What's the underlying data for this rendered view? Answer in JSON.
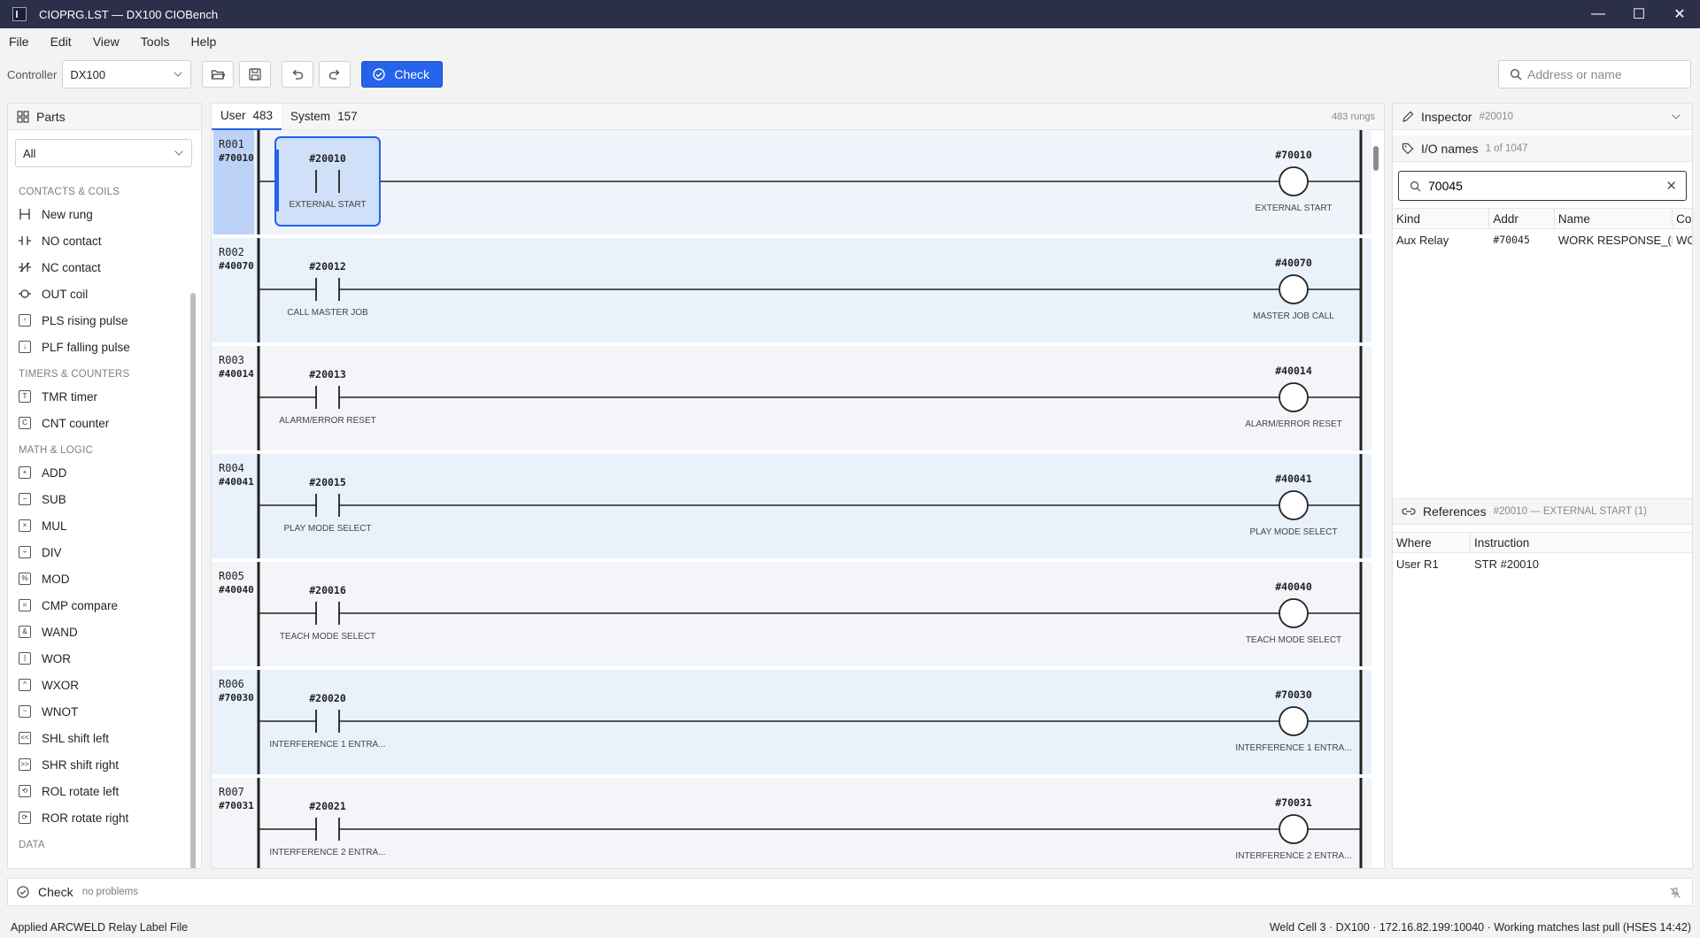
{
  "window": {
    "title": "CIOPRG.LST — DX100 CIOBench",
    "min": "—",
    "max": "☐",
    "close": "✕"
  },
  "menu": [
    "File",
    "Edit",
    "View",
    "Tools",
    "Help"
  ],
  "toolbar": {
    "controller_label": "Controller",
    "controller_value": "DX100",
    "check_label": "Check",
    "search_placeholder": "Address or name"
  },
  "parts": {
    "title": "Parts",
    "filter": "All",
    "groups": [
      {
        "name": "CONTACTS & COILS",
        "items": [
          {
            "label": "New rung",
            "icon": "new-rung-icon",
            "glyph": ""
          },
          {
            "label": "NO contact",
            "icon": "no-contact-icon",
            "glyph": ""
          },
          {
            "label": "NC contact",
            "icon": "nc-contact-icon",
            "glyph": ""
          },
          {
            "label": "OUT coil",
            "icon": "out-coil-icon",
            "glyph": ""
          },
          {
            "label": "PLS rising pulse",
            "icon": "pls-pulse-icon",
            "glyph": "↑"
          },
          {
            "label": "PLF falling pulse",
            "icon": "plf-pulse-icon",
            "glyph": "↓"
          }
        ]
      },
      {
        "name": "TIMERS & COUNTERS",
        "items": [
          {
            "label": "TMR timer",
            "icon": "timer-icon",
            "glyph": "T"
          },
          {
            "label": "CNT counter",
            "icon": "counter-icon",
            "glyph": "C"
          }
        ]
      },
      {
        "name": "MATH & LOGIC",
        "items": [
          {
            "label": "ADD",
            "icon": "add-icon",
            "glyph": "+"
          },
          {
            "label": "SUB",
            "icon": "sub-icon",
            "glyph": "−"
          },
          {
            "label": "MUL",
            "icon": "mul-icon",
            "glyph": "×"
          },
          {
            "label": "DIV",
            "icon": "div-icon",
            "glyph": "÷"
          },
          {
            "label": "MOD",
            "icon": "mod-icon",
            "glyph": "%"
          },
          {
            "label": "CMP compare",
            "icon": "compare-icon",
            "glyph": "="
          },
          {
            "label": "WAND",
            "icon": "wand-icon",
            "glyph": "&"
          },
          {
            "label": "WOR",
            "icon": "wor-icon",
            "glyph": "|"
          },
          {
            "label": "WXOR",
            "icon": "wxor-icon",
            "glyph": "^"
          },
          {
            "label": "WNOT",
            "icon": "wnot-icon",
            "glyph": "~"
          },
          {
            "label": "SHL shift left",
            "icon": "shift-left-icon",
            "glyph": "<<"
          },
          {
            "label": "SHR shift right",
            "icon": "shift-right-icon",
            "glyph": ">>"
          },
          {
            "label": "ROL rotate left",
            "icon": "rotate-left-icon",
            "glyph": "⟲"
          },
          {
            "label": "ROR rotate right",
            "icon": "rotate-right-icon",
            "glyph": "⟳"
          }
        ]
      },
      {
        "name": "DATA",
        "items": []
      }
    ]
  },
  "ladder": {
    "tabs": [
      {
        "label": "User",
        "count": "483"
      },
      {
        "label": "System",
        "count": "157"
      }
    ],
    "rung_count": "483 rungs",
    "rungs": [
      {
        "id": "R001",
        "addr": "#70010",
        "contact": "#20010",
        "contact_label": "EXTERNAL START",
        "coil": "#70010",
        "coil_label": "EXTERNAL START",
        "selected": true
      },
      {
        "id": "R002",
        "addr": "#40070",
        "contact": "#20012",
        "contact_label": "CALL MASTER JOB",
        "coil": "#40070",
        "coil_label": "MASTER JOB CALL",
        "selected": false
      },
      {
        "id": "R003",
        "addr": "#40014",
        "contact": "#20013",
        "contact_label": "ALARM/ERROR RESET",
        "coil": "#40014",
        "coil_label": "ALARM/ERROR RESET",
        "selected": false
      },
      {
        "id": "R004",
        "addr": "#40041",
        "contact": "#20015",
        "contact_label": "PLAY MODE SELECT",
        "coil": "#40041",
        "coil_label": "PLAY MODE SELECT",
        "selected": false
      },
      {
        "id": "R005",
        "addr": "#40040",
        "contact": "#20016",
        "contact_label": "TEACH MODE SELECT",
        "coil": "#40040",
        "coil_label": "TEACH MODE SELECT",
        "selected": false
      },
      {
        "id": "R006",
        "addr": "#70030",
        "contact": "#20020",
        "contact_label": "INTERFERENCE 1 ENTRA...",
        "coil": "#70030",
        "coil_label": "INTERFERENCE 1 ENTRA...",
        "selected": false
      },
      {
        "id": "R007",
        "addr": "#70031",
        "contact": "#20021",
        "contact_label": "INTERFERENCE 2 ENTRA...",
        "coil": "#70031",
        "coil_label": "INTERFERENCE 2 ENTRA...",
        "selected": false
      }
    ]
  },
  "inspector": {
    "title": "Inspector",
    "target": "#20010",
    "io": {
      "title": "I/O names",
      "count": "1 of 1047",
      "query": "70045",
      "columns": [
        "Kind",
        "Addr",
        "Name",
        "Co"
      ],
      "rows": [
        {
          "kind": "Aux Relay",
          "addr": "#70045",
          "name": "WORK RESPONSE_(PSI",
          "co": "WO"
        }
      ]
    },
    "refs": {
      "title": "References",
      "sub": "#20010 — EXTERNAL START  (1)",
      "columns": [
        "Where",
        "Instruction"
      ],
      "rows": [
        {
          "where": "User R1",
          "instr": "STR #20010"
        }
      ]
    }
  },
  "check_bar": {
    "label": "Check",
    "status": "no problems"
  },
  "statusbar": {
    "left": "Applied ARCWELD Relay Label File",
    "right": "Weld Cell 3 · DX100 · 172.16.82.199:10040 · Working matches last pull (HSES 14:42)"
  },
  "colors": {
    "accent": "#2563eb",
    "titlebar": "#2b2f4a",
    "rung_alt": "#e9f1fb",
    "selection": "#bcd3f7"
  }
}
